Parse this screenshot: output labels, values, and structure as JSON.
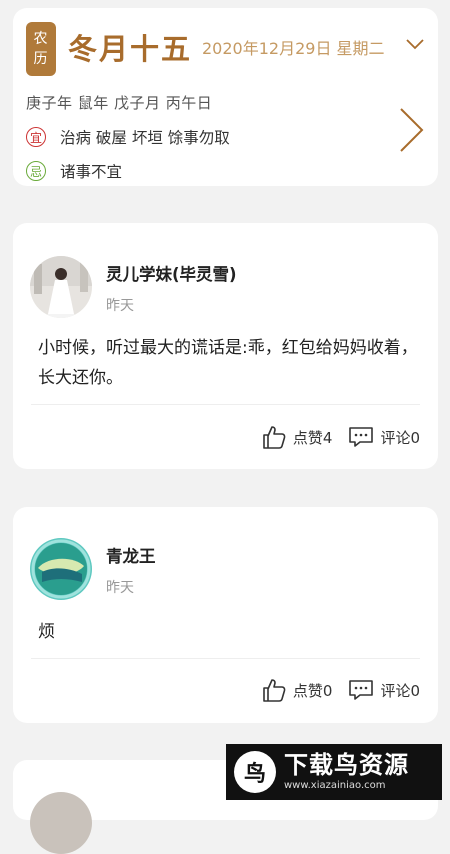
{
  "almanac": {
    "badge_top": "农",
    "badge_bottom": "历",
    "lunar_day": "冬月十五",
    "solar_date": "2020年12月29日 星期二",
    "ganzhi": "庚子年 鼠年 戊子月 丙午日",
    "yi_mark": "宜",
    "yi_text": "治病 破屋 坏垣 馀事勿取",
    "ji_mark": "忌",
    "ji_text": "诸事不宜"
  },
  "posts": [
    {
      "name": "灵儿学妹(毕灵雪)",
      "time": "昨天",
      "content": "小时候，听过最大的谎话是:乖，红包给妈妈收着，长大还你。",
      "like_label": "点赞4",
      "comment_label": "评论0"
    },
    {
      "name": "青龙王",
      "time": "昨天",
      "content": "烦",
      "like_label": "点赞0",
      "comment_label": "评论0"
    }
  ],
  "watermark": {
    "title": "下载鸟资源",
    "url": "www.xiazainiao.com",
    "logo_char": "鸟"
  },
  "colors": {
    "accent_brown": "#a86c2c",
    "badge_bg": "#b07a3a",
    "yi_red": "#cc3333",
    "ji_green": "#6aaa3a"
  }
}
